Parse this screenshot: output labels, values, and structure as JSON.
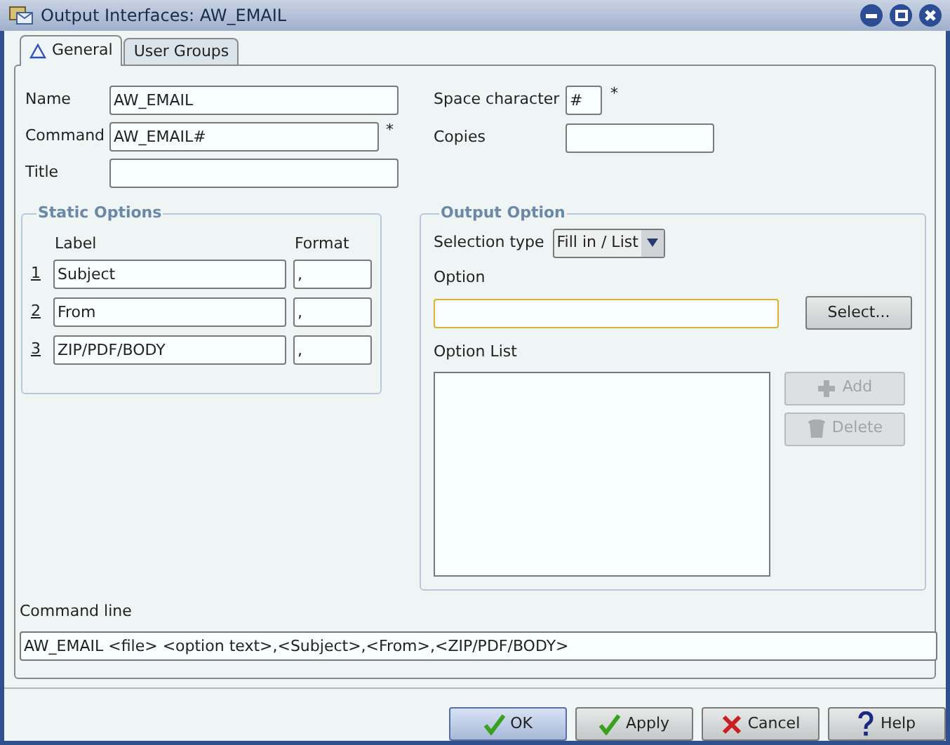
{
  "window": {
    "title": "Output Interfaces: AW_EMAIL"
  },
  "tabs": [
    {
      "label": "General",
      "selected": true
    },
    {
      "label": "User Groups",
      "selected": false
    }
  ],
  "general": {
    "name": {
      "label": "Name",
      "value": "AW_EMAIL"
    },
    "command": {
      "label": "Command",
      "value": "AW_EMAIL#",
      "required_mark": "*"
    },
    "title": {
      "label": "Title"
    },
    "space_character": {
      "label": "Space character",
      "value": "#",
      "required_mark": "*"
    },
    "copies": {
      "label": "Copies"
    }
  },
  "static_options": {
    "title": "Static Options",
    "columns": [
      "Label",
      "Format"
    ],
    "rows": [
      {
        "number": "1",
        "label": "Subject",
        "format": ","
      },
      {
        "number": "2",
        "label": "From",
        "format": ","
      },
      {
        "number": "3",
        "label": "ZIP/PDF/BODY",
        "format": ","
      }
    ]
  },
  "output_option": {
    "title": "Output Option",
    "selection_type": {
      "label": "Selection type",
      "value": "Fill in / List"
    },
    "option": {
      "label": "Option",
      "focused": true
    },
    "select_button": "Select...",
    "option_list": {
      "label": "Option List"
    },
    "buttons": [
      {
        "kind": "add",
        "label": "Add",
        "disabled": true
      },
      {
        "kind": "delete",
        "label": "Delete",
        "disabled": true
      }
    ]
  },
  "command_line": {
    "label": "Command line",
    "value": "AW_EMAIL <file> <option text>,<Subject>,<From>,<ZIP/PDF/BODY>"
  },
  "buttons": [
    {
      "kind": "ok",
      "label": "OK",
      "default": true
    },
    {
      "kind": "apply",
      "label": "Apply",
      "default": false
    },
    {
      "kind": "cancel",
      "label": "Cancel",
      "default": false
    },
    {
      "kind": "help",
      "label": "Help",
      "default": false
    }
  ]
}
